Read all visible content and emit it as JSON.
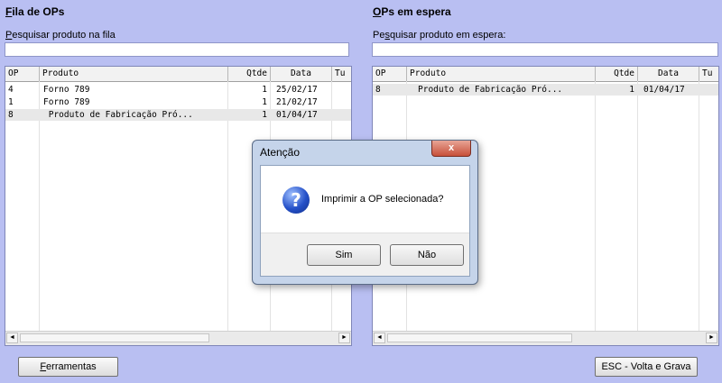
{
  "left_panel": {
    "title_first": "F",
    "title_rest": "ila de OPs",
    "search_label_first": "P",
    "search_label_rest": "esquisar produto na fila",
    "search_value": "",
    "columns": [
      "OP",
      "Produto",
      "Qtde",
      "Data",
      "Tu"
    ],
    "rows": [
      {
        "op": "4",
        "produto": "Forno 789",
        "qtde": "1",
        "data": "25/02/17",
        "tu": ""
      },
      {
        "op": "1",
        "produto": "Forno 789",
        "qtde": "1",
        "data": "21/02/17",
        "tu": ""
      },
      {
        "op": "8",
        "produto": " Produto de Fabricação Pró...",
        "qtde": "1",
        "data": "01/04/17",
        "tu": ""
      }
    ]
  },
  "right_panel": {
    "title_first": "O",
    "title_rest": "Ps em espera",
    "search_label_first": "Pe",
    "search_label_mid": "s",
    "search_label_rest": "quisar produto em espera:",
    "search_value": "",
    "columns": [
      "OP",
      "Produto",
      "Qtde",
      "Data",
      "Tu"
    ],
    "rows": [
      {
        "op": "8",
        "produto": "Produto de Fabricação Pró...",
        "qtde": "1",
        "data": "01/04/17",
        "tu": ""
      }
    ]
  },
  "dialog": {
    "title": "Atenção",
    "close_glyph": "x",
    "icon": "question-icon",
    "icon_glyph": "?",
    "message": "Imprimir a OP selecionada?",
    "yes_label": "Sim",
    "no_label": "Não"
  },
  "footer": {
    "tools_label_first": "F",
    "tools_label_rest": "erramentas",
    "back_label": "ESC - Volta e Grava"
  },
  "scroll_glyphs": {
    "left": "◄",
    "right": "►"
  }
}
